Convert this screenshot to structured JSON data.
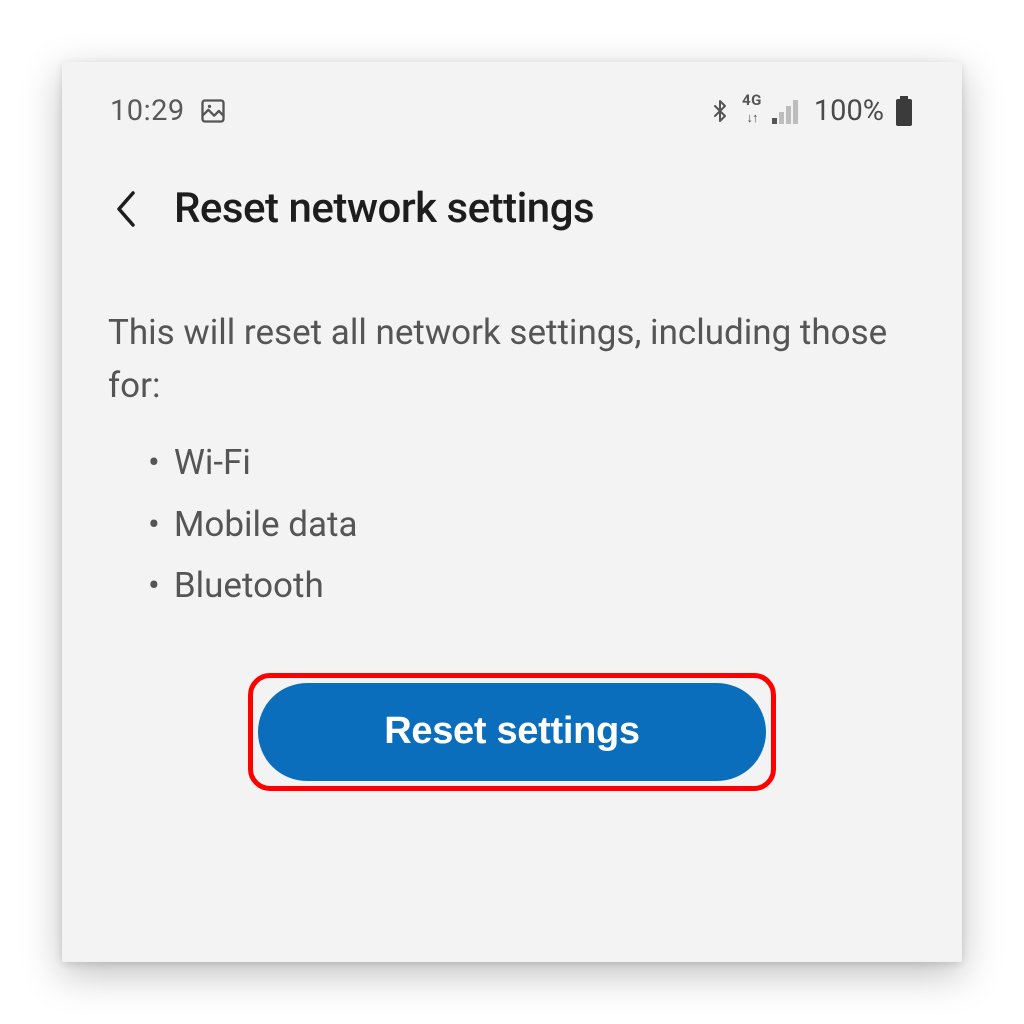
{
  "status": {
    "time": "10:29",
    "network_type": "4G",
    "battery_pct": "100%"
  },
  "header": {
    "title": "Reset network settings"
  },
  "body": {
    "intro": "This will reset all network settings, including those for:",
    "items": [
      "Wi-Fi",
      "Mobile data",
      "Bluetooth"
    ]
  },
  "button": {
    "label": "Reset settings"
  }
}
